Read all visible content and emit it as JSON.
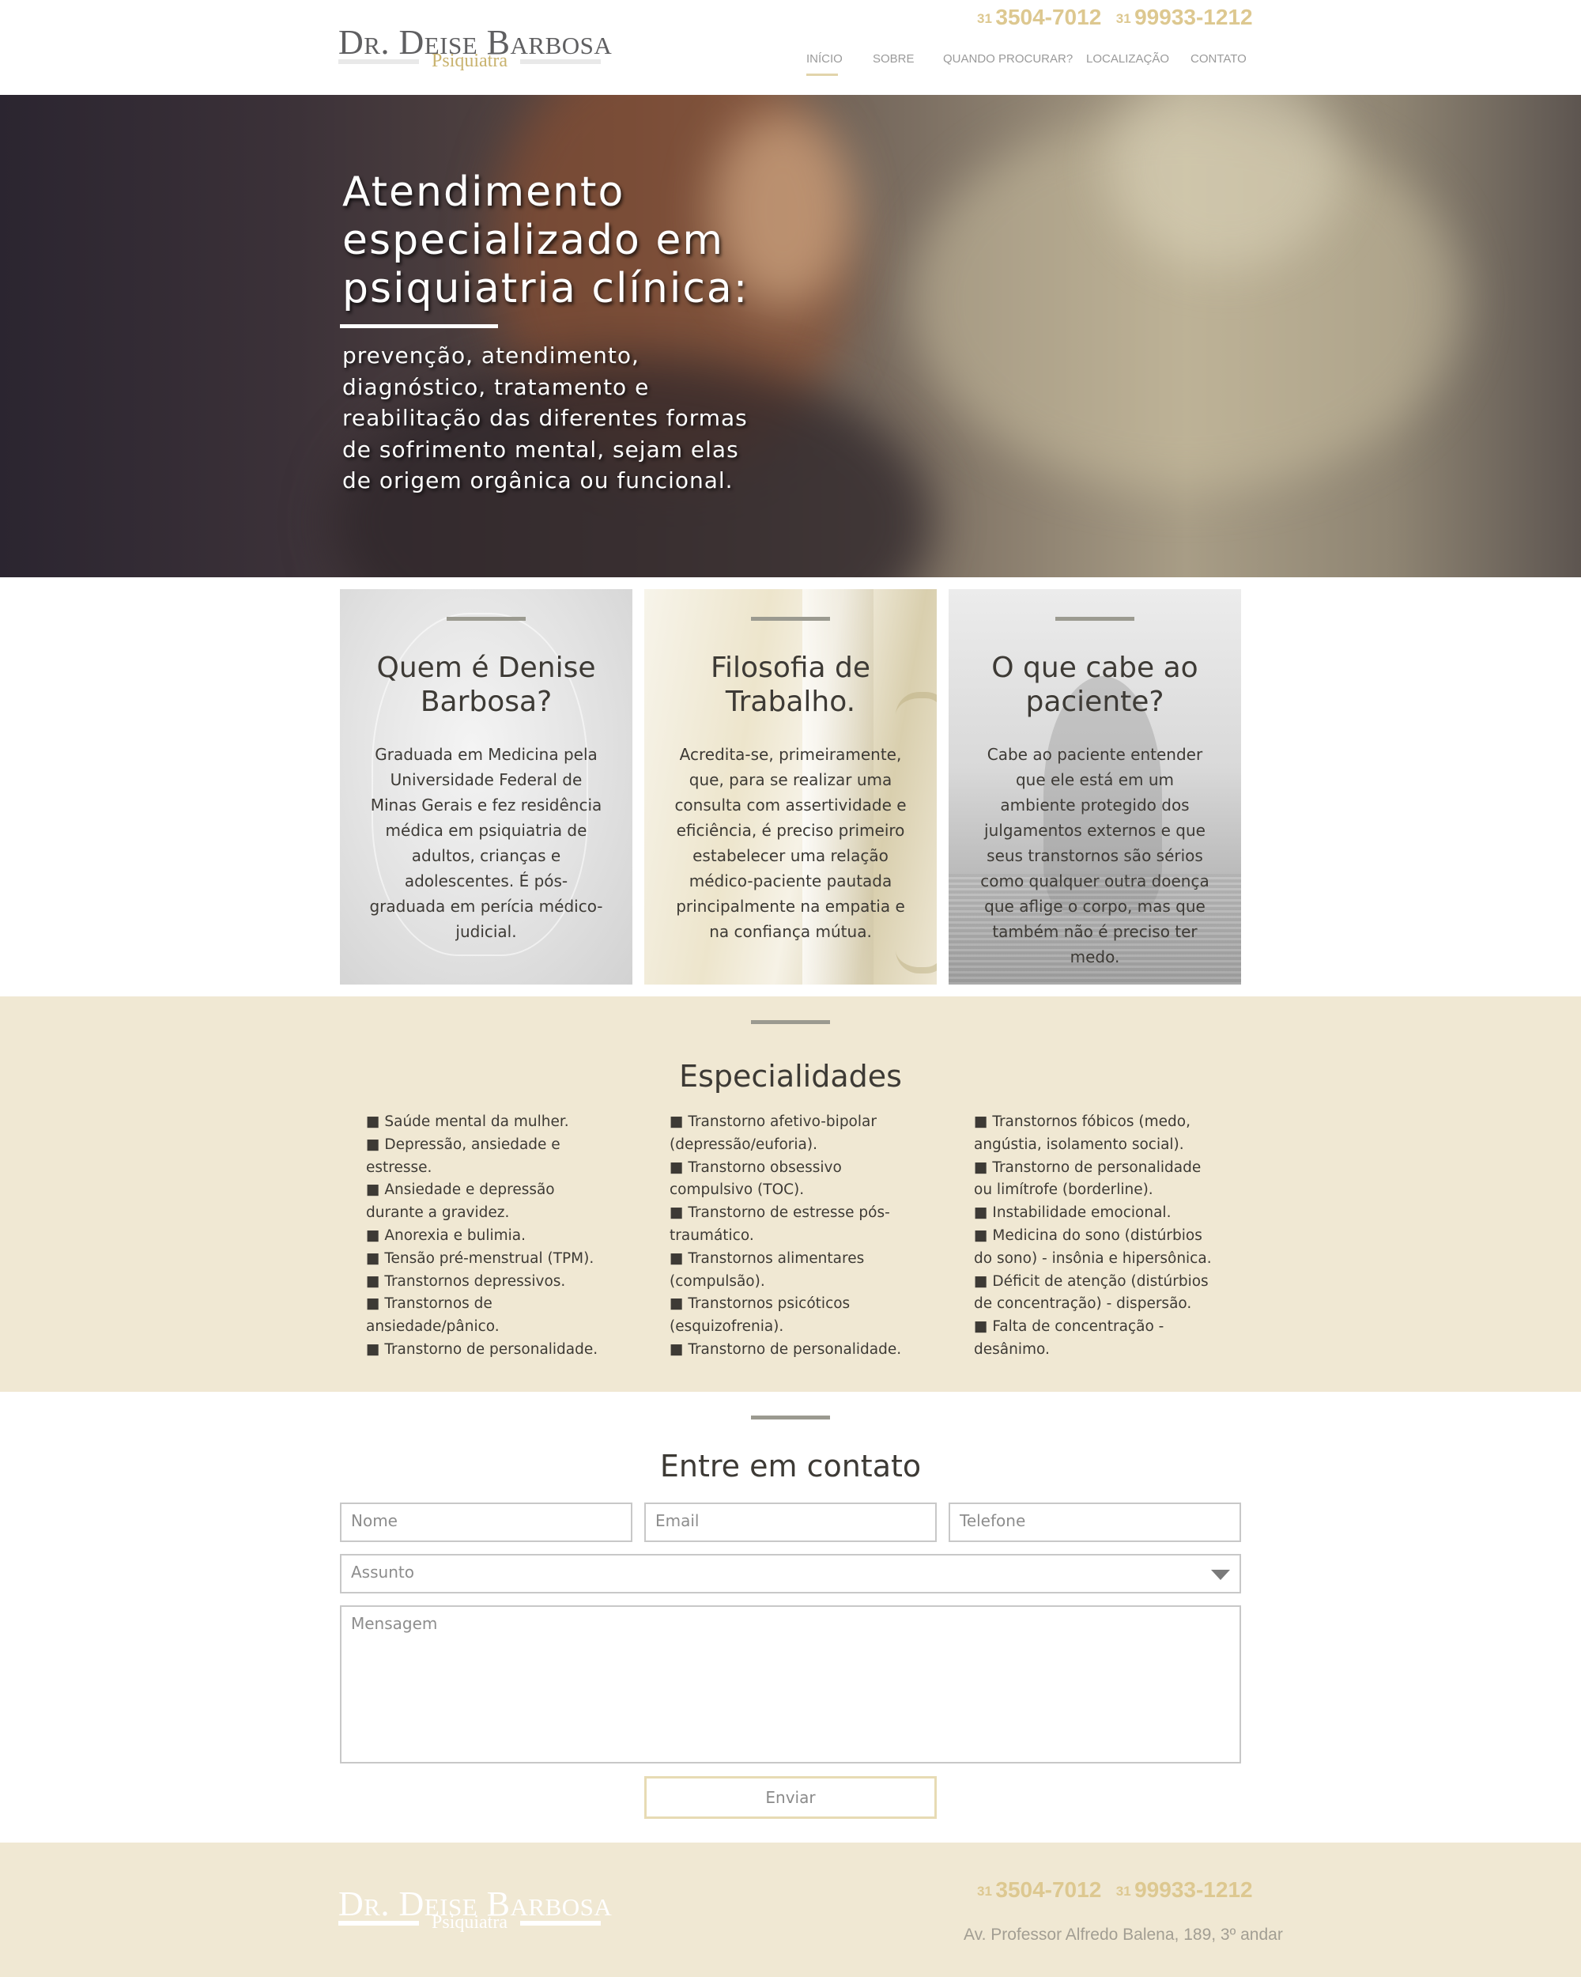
{
  "header": {
    "logo_main": "Dr. Deise Barbosa",
    "logo_sub": "Psiquiatra",
    "phones": [
      {
        "ddd": "31",
        "number": "3504-7012"
      },
      {
        "ddd": "31",
        "number": "99933-1212"
      }
    ],
    "nav": [
      {
        "label": "INÍCIO",
        "active": true
      },
      {
        "label": "SOBRE",
        "active": false
      },
      {
        "label": "QUANDO PROCURAR?",
        "active": false
      },
      {
        "label": "LOCALIZAÇÃO",
        "active": false
      },
      {
        "label": "CONTATO",
        "active": false
      }
    ]
  },
  "hero": {
    "title_lines": [
      "Atendimento",
      "especializado em",
      "psiquiatria clínica:"
    ],
    "subtitle": "prevenção, atendimento, diagnóstico, tratamento e reabilitação das diferentes formas de sofrimento mental, sejam elas de origem orgânica ou funcional."
  },
  "cards": [
    {
      "title": "Quem é Denise Barbosa?",
      "body": "Graduada em Medicina pela Universidade Federal de Minas Gerais e fez residência médica em psiquiatria de adultos, crianças e adolescentes. É pós-graduada em perícia médico-judicial."
    },
    {
      "title": "Filosofia de Trabalho.",
      "body": "Acredita-se, primeiramente, que, para se realizar uma consulta com assertividade e eficiência, é preciso primeiro estabelecer uma relação médico-paciente pautada principalmente na empatia e na confiança mútua."
    },
    {
      "title": "O que cabe ao paciente?",
      "body": "Cabe ao paciente entender que ele está em um ambiente protegido dos julgamentos externos e que seus transtornos são sérios como qualquer outra doença que aflige o corpo, mas que também não é preciso ter medo."
    }
  ],
  "specialties": {
    "title": "Especialidades",
    "columns": [
      [
        "■ Saúde mental da mulher.",
        "■ Depressão, ansiedade e estresse.",
        "■ Ansiedade e depressão durante a gravidez.",
        "■ Anorexia e bulimia.",
        "■ Tensão pré-menstrual (TPM).",
        "■ Transtornos depressivos.",
        "■ Transtornos de ansiedade/pânico.",
        "■ Transtorno de personalidade."
      ],
      [
        "■ Transtorno afetivo-bipolar (depressão/euforia).",
        "■ Transtorno obsessivo compulsivo (TOC).",
        "■ Transtorno de estresse pós-traumático.",
        "■ Transtornos alimentares (compulsão).",
        "■ Transtornos psicóticos (esquizofrenia).",
        "■ Transtorno de personalidade."
      ],
      [
        "■ Transtornos fóbicos (medo, angústia, isolamento social).",
        "■ Transtorno de personalidade ou limítrofe (borderline).",
        "■ Instabilidade emocional.",
        "■ Medicina do sono (distúrbios do sono) - insônia e hipersônica.",
        "■ Déficit de atenção (distúrbios de concentração) - dispersão.",
        "■ Falta de concentração - desânimo."
      ]
    ]
  },
  "contact": {
    "title": "Entre em contato",
    "name_placeholder": "Nome",
    "email_placeholder": "Email",
    "phone_placeholder": "Telefone",
    "subject_value": "Assunto",
    "message_placeholder": "Mensagem",
    "send_label": "Enviar"
  },
  "footer": {
    "logo_main": "Dr. Deise Barbosa",
    "logo_sub": "Psiquiatra",
    "phones": [
      {
        "ddd": "31",
        "number": "3504-7012"
      },
      {
        "ddd": "31",
        "number": "99933-1212"
      }
    ],
    "address": "Av. Professor Alfredo Balena, 189, 3º andar"
  },
  "colors": {
    "accent_gold": "#ddc890",
    "beige_band": "#f0e8d3",
    "text_dark": "#3d3a35",
    "divider_gray": "#9b9a90"
  }
}
